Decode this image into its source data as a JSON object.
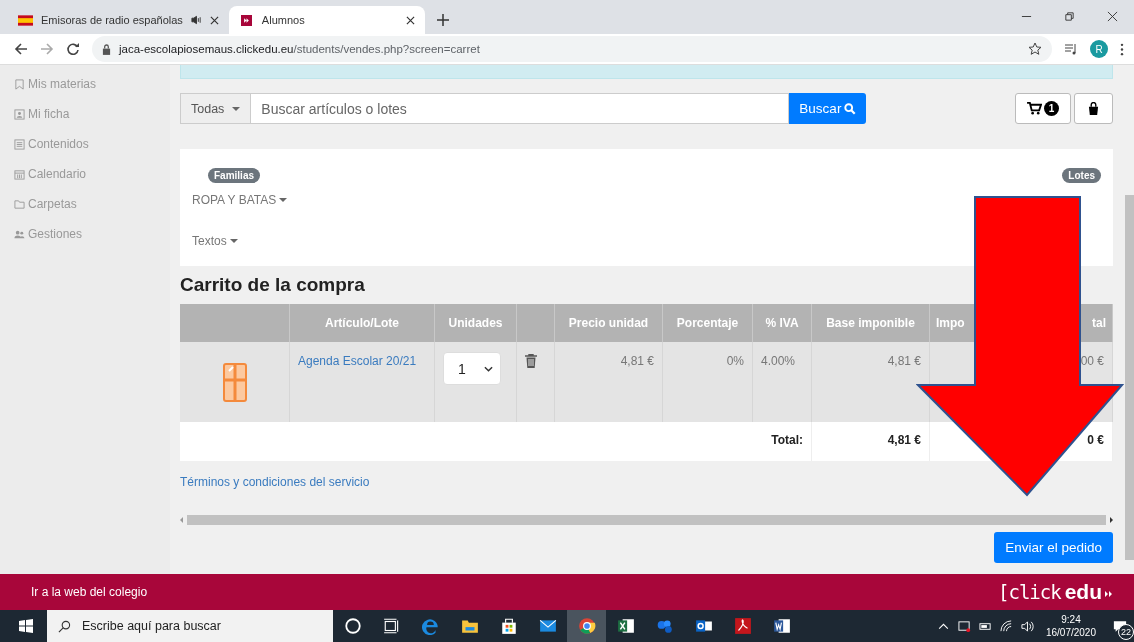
{
  "browser": {
    "tabs": [
      {
        "title": "Emisoras de radio españolas",
        "selected": false,
        "kind": "flag"
      },
      {
        "title": "Alumnos",
        "selected": true,
        "kind": "site"
      }
    ],
    "url_host": "jaca-escolapiosemaus.clickedu.eu",
    "url_path": "/students/vendes.php?screen=carret",
    "profile": "R"
  },
  "sidebar": {
    "items": [
      {
        "label": "Mis materias",
        "kind": "bookmark"
      },
      {
        "label": "Mi ficha",
        "kind": "profile"
      },
      {
        "label": "Contenidos",
        "kind": "document"
      },
      {
        "label": "Calendario",
        "kind": "calendar"
      },
      {
        "label": "Carpetas",
        "kind": "folder"
      },
      {
        "label": "Gestiones",
        "kind": "people"
      }
    ]
  },
  "search": {
    "scope": "Todas",
    "placeholder": "Buscar artículos o lotes",
    "button": "Buscar",
    "cart_count": "1"
  },
  "filters": {
    "families_label": "Familias",
    "lots_label": "Lotes",
    "families": [
      "ROPA Y BATAS",
      "Textos"
    ]
  },
  "cart": {
    "title": "Carrito de la compra",
    "columns": [
      {
        "kind": "image"
      },
      {
        "kind": "text",
        "label": "Artículo/Lote"
      },
      {
        "kind": "text",
        "label": "Unidades"
      },
      {
        "kind": "action"
      },
      {
        "kind": "text",
        "label": "Precio unidad"
      },
      {
        "kind": "text",
        "label": "Porcentaje"
      },
      {
        "kind": "text",
        "label": "% IVA"
      },
      {
        "kind": "text",
        "label": "Base imponible"
      },
      {
        "kind": "covered",
        "label_start": "Impo",
        "label_end": "tal"
      }
    ],
    "rows": [
      {
        "item": "Agenda Escolar 20/21",
        "quantity": "1",
        "unit_price": "4,81 €",
        "percent": "0%",
        "vat": "4.00%",
        "base": "4,81 €",
        "total": "00 €"
      }
    ],
    "total_label": "Total:",
    "total_base": "4,81 €",
    "total_amount": "0 €"
  },
  "terms_link": "Términos y condiciones del servicio",
  "submit_button": "Enviar el pedido",
  "footer": {
    "link": "Ir a la web del colegio",
    "logo_light": "[click",
    "logo_bold": "edu"
  },
  "taskbar": {
    "search_placeholder": "Escribe aquí para buscar",
    "apps": [
      {
        "kind": "cortana",
        "selected": false
      },
      {
        "kind": "taskview",
        "selected": false
      },
      {
        "kind": "edge",
        "selected": false
      },
      {
        "kind": "files",
        "selected": false
      },
      {
        "kind": "store",
        "selected": false
      },
      {
        "kind": "mail",
        "selected": false
      },
      {
        "kind": "chrome",
        "selected": true
      },
      {
        "kind": "excel",
        "selected": false
      },
      {
        "kind": "cloud",
        "selected": false
      },
      {
        "kind": "outlook",
        "selected": false
      },
      {
        "kind": "acrobat",
        "selected": false
      },
      {
        "kind": "word",
        "selected": false
      }
    ],
    "time": "9:24",
    "date": "16/07/2020",
    "notifications": "22"
  }
}
